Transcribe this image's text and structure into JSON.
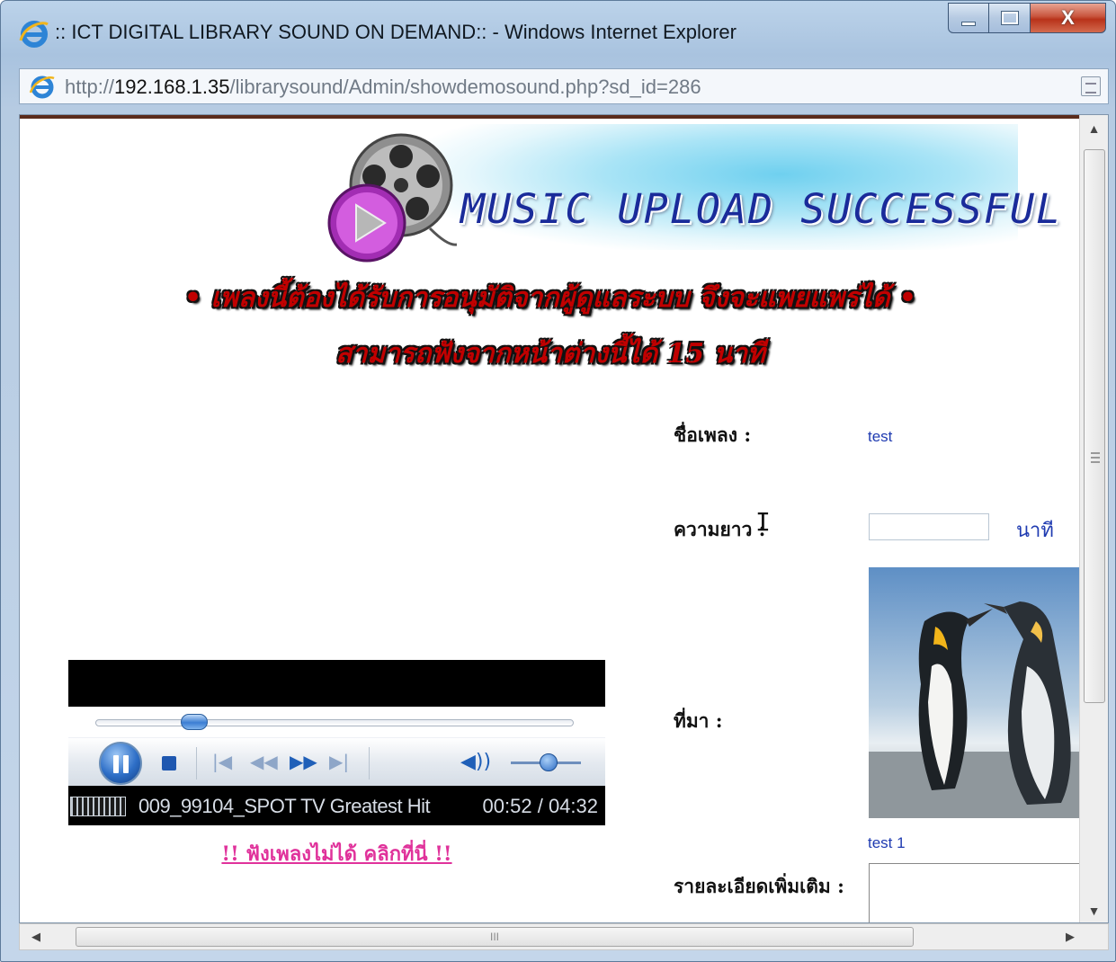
{
  "window": {
    "title": ":: ICT DIGITAL LIBRARY SOUND ON DEMAND:: - Windows Internet Explorer",
    "close_glyph": "X"
  },
  "address": {
    "url_prefix": "http://",
    "url_host": "192.168.1.35",
    "url_path": "/librarysound/Admin/showdemosound.php?sd_id=286"
  },
  "banner": {
    "title": "MUSIC UPLOAD SUCCESSFUL"
  },
  "notice": {
    "line1": "• เพลงนี้ต้องได้รับการอนุมัติจากผู้ดูแลระบบ จึงจะแพยแพร่ได้ •",
    "line2": "สามารถฟังจากหน้าต่างนี้ได้ 15 นาที"
  },
  "player": {
    "track_title": "009_99104_SPOT TV Greatest Hit",
    "time": "00:52 / 04:32",
    "progress_fraction": 0.19,
    "volume_fraction": 0.55,
    "cant_play_link": "!! ฟังเพลงไม่ได้ คลิกที่นี่ !!"
  },
  "details": {
    "song_label": "ชื่อเพลง :",
    "song_value": "test",
    "length_label": "ความยาว :",
    "length_value": "",
    "length_unit": "นาที",
    "source_label": "ที่มา :",
    "source_caption": "test 1",
    "more_label": "รายละเอียดเพิ่มเติม :",
    "more_value": ""
  },
  "scrollbar": {
    "h_grip": "III"
  },
  "colors": {
    "link_blue": "#1f3bb1",
    "notice_red": "#c10000",
    "cant_play_pink": "#e0329b",
    "banner_blue": "#1a2b9a"
  },
  "icons": [
    "ie-logo-icon",
    "film-reel-icon",
    "play-pause-icon",
    "stop-icon",
    "previous-icon",
    "rewind-icon",
    "fast-forward-icon",
    "next-icon",
    "volume-icon",
    "compat-view-icon"
  ]
}
